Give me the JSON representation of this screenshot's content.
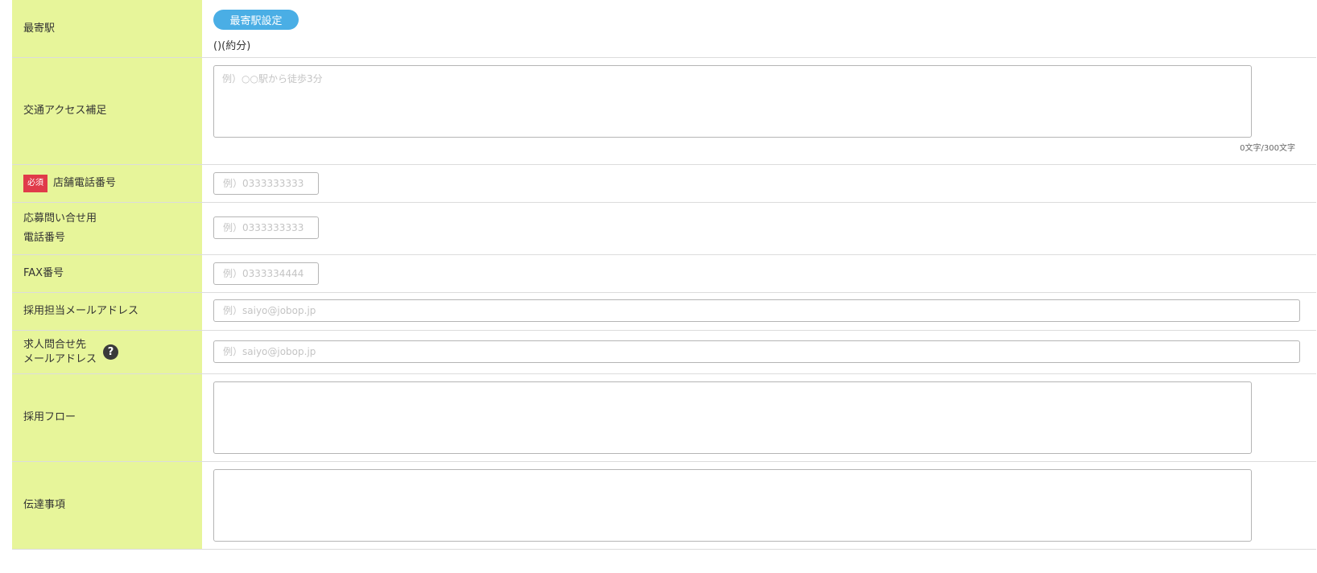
{
  "station": {
    "label": "最寄駅",
    "button": "最寄駅設定",
    "text": "()(約分)"
  },
  "access": {
    "label": "交通アクセス補足",
    "placeholder": "例）○○駅から徒歩3分",
    "value": "",
    "counter": "0文字/300文字"
  },
  "store_phone": {
    "required_badge": "必須",
    "label": "店舗電話番号",
    "placeholder": "例）0333333333",
    "value": ""
  },
  "inquiry_phone": {
    "label_line1": "応募問い合せ用",
    "label_line2": "電話番号",
    "placeholder": "例）0333333333",
    "value": ""
  },
  "fax": {
    "label": "FAX番号",
    "placeholder": "例）0333334444",
    "value": ""
  },
  "recruit_email": {
    "label": "採用担当メールアドレス",
    "placeholder": "例）saiyo@jobop.jp",
    "value": ""
  },
  "inquiry_email": {
    "label_line1": "求人問合せ先",
    "label_line2": "メールアドレス",
    "help_icon": "question-circle-icon",
    "help_glyph": "?",
    "placeholder": "例）saiyo@jobop.jp",
    "value": ""
  },
  "flow": {
    "label": "採用フロー",
    "value": ""
  },
  "notes": {
    "label": "伝達事項",
    "value": ""
  },
  "colors": {
    "label_bg": "#e7f59a",
    "button_bg": "#4aaee5",
    "required_bg": "#e03b4a",
    "border": "#dcdcdc"
  }
}
